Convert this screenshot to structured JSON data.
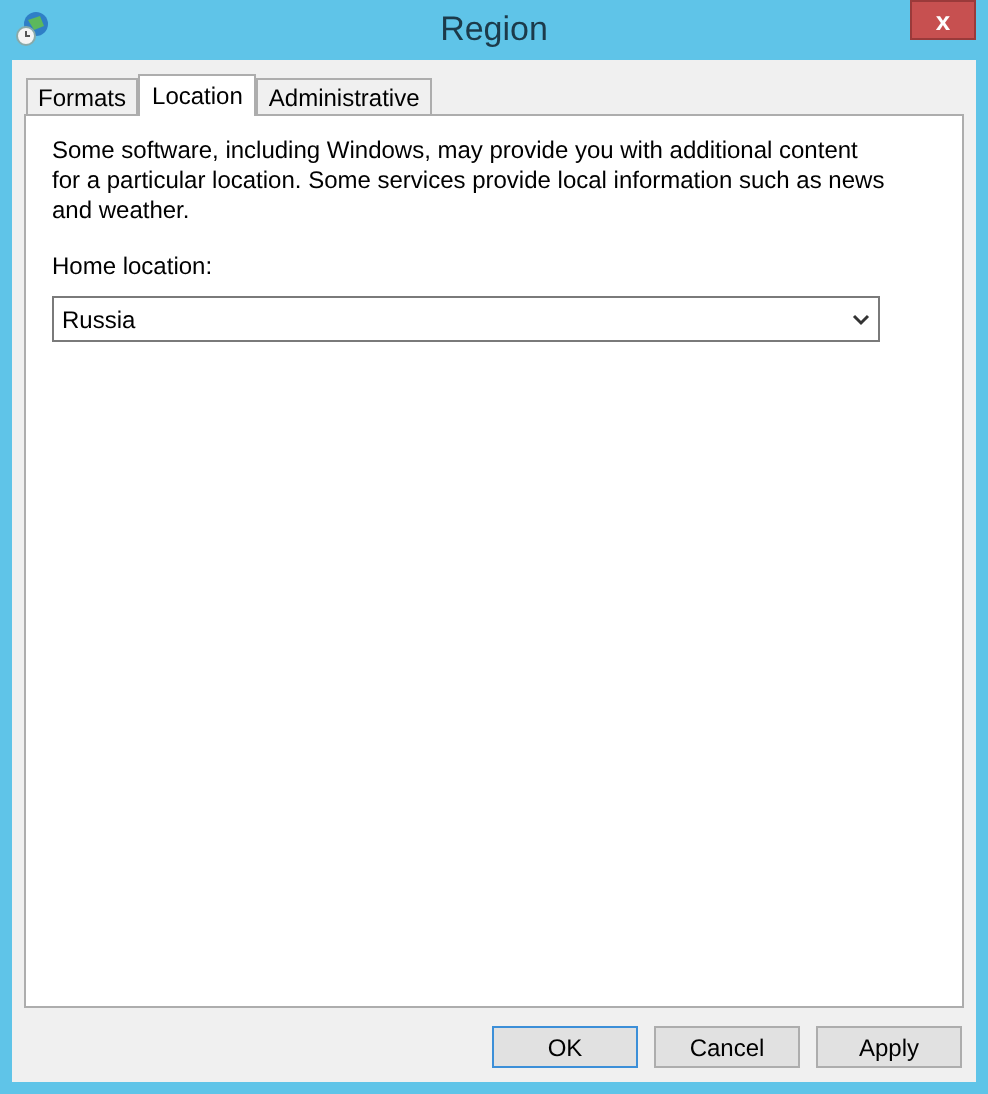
{
  "window": {
    "title": "Region",
    "close": "x"
  },
  "tabs": [
    {
      "label": "Formats",
      "selected": false
    },
    {
      "label": "Location",
      "selected": true
    },
    {
      "label": "Administrative",
      "selected": false
    }
  ],
  "location": {
    "description": "Some software, including Windows, may provide you with additional content for a particular location. Some services provide local information such as news and weather.",
    "home_label": "Home location:",
    "home_value": "Russia"
  },
  "buttons": [
    {
      "label": "OK",
      "default": true
    },
    {
      "label": "Cancel",
      "default": false
    },
    {
      "label": "Apply",
      "default": false
    }
  ]
}
